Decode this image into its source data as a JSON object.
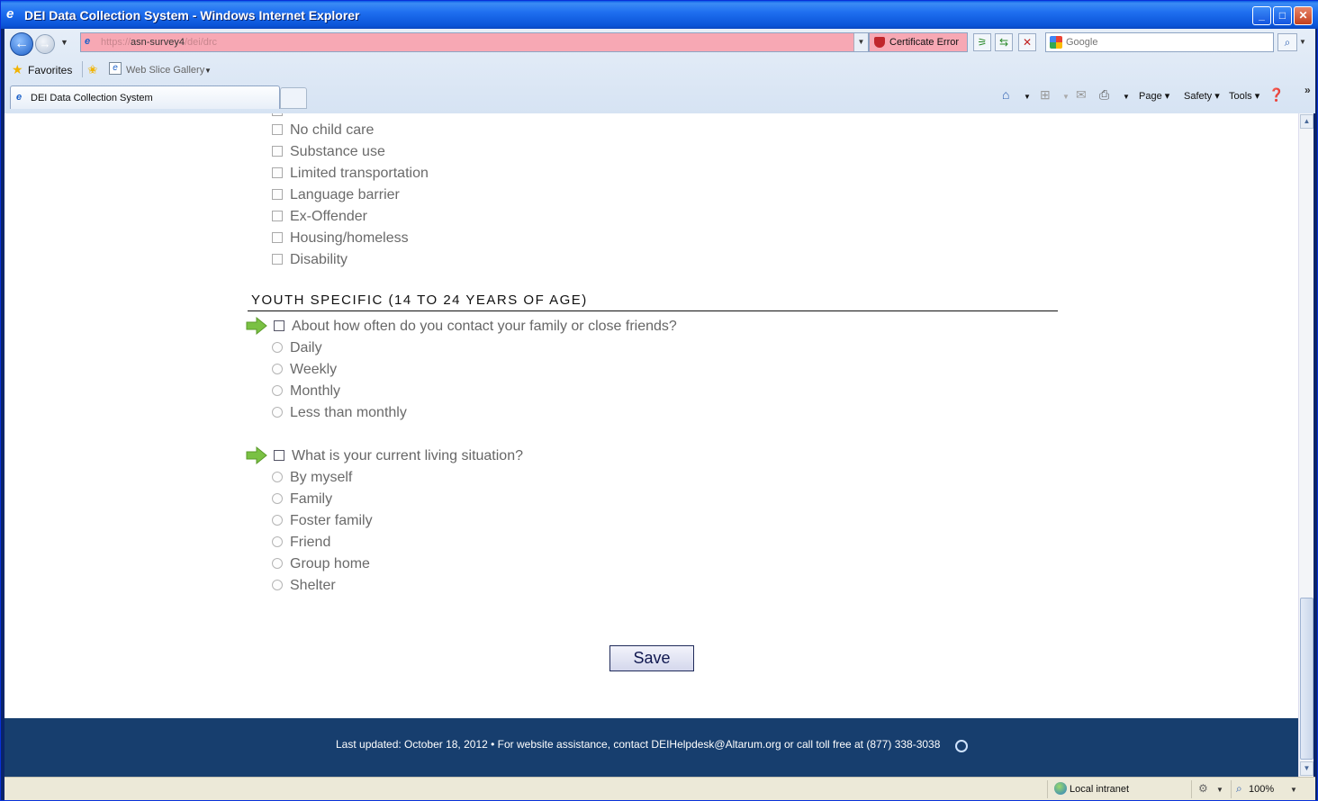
{
  "window": {
    "title": "DEI Data Collection System - Windows Internet Explorer"
  },
  "browser": {
    "url_scheme": "https://",
    "url_host": "asn-survey4",
    "url_path": "/dei/drc",
    "cert_error_label": "Certificate Error",
    "search_placeholder": "Google",
    "favorites_label": "Favorites",
    "web_slice_label": "Web Slice Gallery",
    "tab_title": "DEI Data Collection System",
    "commands": {
      "page": "Page",
      "safety": "Safety",
      "tools": "Tools"
    }
  },
  "form": {
    "barriers": [
      "No child care",
      "Substance use",
      "Limited transportation",
      "Language barrier",
      "Ex-Offender",
      "Housing/homeless",
      "Disability"
    ],
    "section_title": "YOUTH SPECIFIC (14 TO 24 YEARS OF AGE)",
    "questions": [
      {
        "label": "About how often do you contact your family or close friends?",
        "options": [
          "Daily",
          "Weekly",
          "Monthly",
          "Less than monthly"
        ]
      },
      {
        "label": "What is your current living situation?",
        "options": [
          "By myself",
          "Family",
          "Foster family",
          "Friend",
          "Group home",
          "Shelter"
        ]
      }
    ],
    "save_label": "Save"
  },
  "footer": {
    "text": "Last updated: October 18, 2012 • For website assistance, contact DEIHelpdesk@Altarum.org or call toll free at (877) 338-3038"
  },
  "status": {
    "zone": "Local intranet",
    "zoom": "100%"
  },
  "colors": {
    "footer_bg": "#173e6e",
    "cert_error_bg": "#f7a8b4",
    "arrow_green": "#7ac143"
  }
}
